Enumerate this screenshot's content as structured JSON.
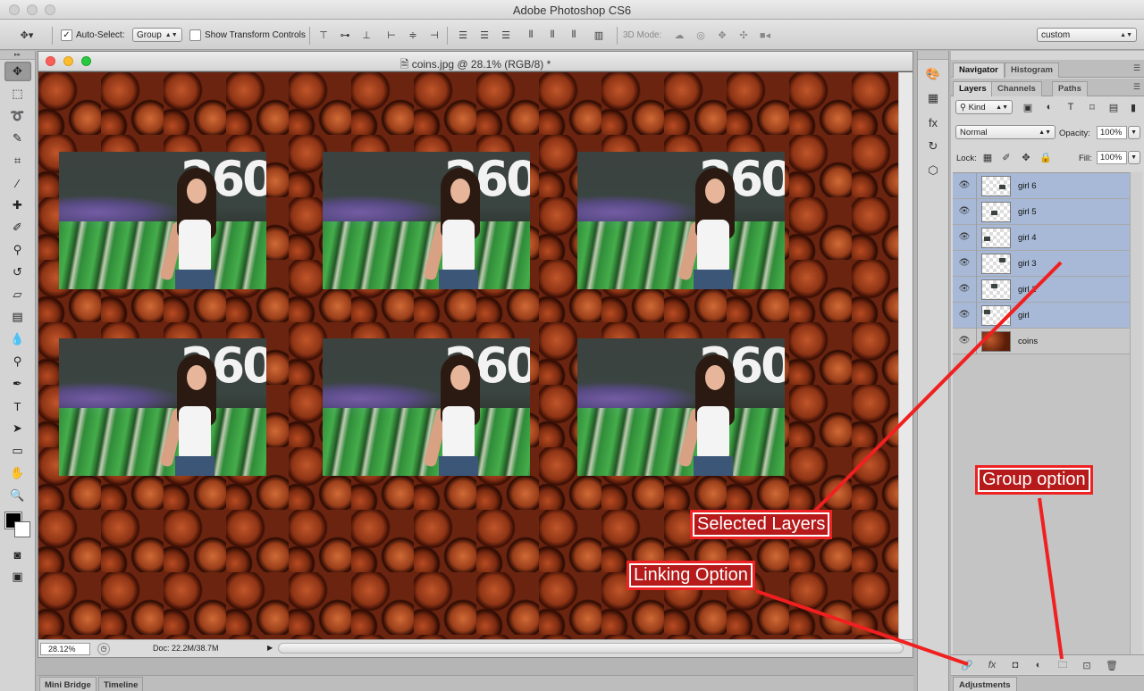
{
  "app": {
    "title": "Adobe Photoshop CS6"
  },
  "options_bar": {
    "auto_select_label": "Auto-Select:",
    "auto_select_checked": true,
    "auto_select_target": "Group",
    "show_transform_label": "Show Transform Controls",
    "mode_3d_label": "3D Mode:",
    "workspace": "custom"
  },
  "document": {
    "title": "coins.jpg @ 28.1% (RGB/8) *",
    "zoom": "28.12%",
    "doc_info": "Doc: 22.2M/38.7M"
  },
  "panels": {
    "top_tabs": [
      "Navigator",
      "Histogram"
    ],
    "layer_tabs": [
      "Layers",
      "Channels",
      "Paths"
    ],
    "filter_kind": "Kind",
    "blend_mode": "Normal",
    "opacity_label": "Opacity:",
    "opacity": "100%",
    "lock_label": "Lock:",
    "fill_label": "Fill:",
    "fill": "100%"
  },
  "layers": [
    {
      "name": "girl 6",
      "selected": true
    },
    {
      "name": "girl 5",
      "selected": true
    },
    {
      "name": "girl 4",
      "selected": true
    },
    {
      "name": "girl 3",
      "selected": true
    },
    {
      "name": "girl 2",
      "selected": true
    },
    {
      "name": "girl",
      "selected": true
    },
    {
      "name": "coins",
      "selected": false
    }
  ],
  "bottom_tabs": {
    "mini_bridge": "Mini Bridge",
    "timeline": "Timeline",
    "adjustments": "Adjustments"
  },
  "annotations": {
    "selected_layers": "Selected Layers",
    "linking_option": "Linking Option",
    "group_option": "Group option"
  },
  "colors": {
    "annotation_red": "#ee2222",
    "selected_layer_bg": "#a7b9d6",
    "foreground_swatch": "#000000",
    "background_swatch": "#ffffff"
  },
  "photo_text": "260"
}
